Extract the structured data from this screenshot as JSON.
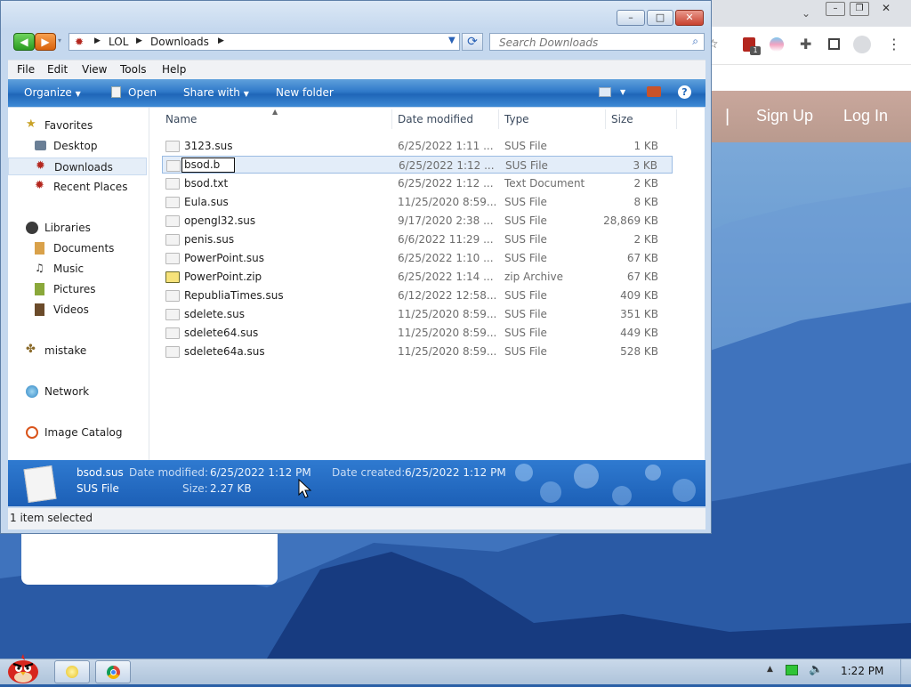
{
  "window": {
    "breadcrumb": [
      "LOL",
      "Downloads"
    ],
    "search_placeholder": "Search Downloads",
    "menu": [
      "File",
      "Edit",
      "View",
      "Tools",
      "Help"
    ],
    "commands": {
      "organize": "Organize",
      "open": "Open",
      "share_with": "Share with",
      "new_folder": "New folder",
      "help": "?"
    },
    "caption": {
      "minimize": "–",
      "maximize": "□",
      "close": "✕"
    }
  },
  "nav": {
    "favorites": "Favorites",
    "desktop": "Desktop",
    "downloads": "Downloads",
    "recent_places": "Recent Places",
    "libraries": "Libraries",
    "documents": "Documents",
    "music": "Music",
    "pictures": "Pictures",
    "videos": "Videos",
    "mistake": "mistake",
    "network": "Network",
    "image_catalog": "Image Catalog"
  },
  "columns": {
    "name": "Name",
    "date": "Date modified",
    "type": "Type",
    "size": "Size"
  },
  "files": [
    {
      "name": "3123.sus",
      "date": "6/25/2022 1:11 ...",
      "type": "SUS File",
      "size": "1 KB"
    },
    {
      "name": "bsod.b",
      "date": "6/25/2022 1:12 ...",
      "type": "SUS File",
      "size": "3 KB"
    },
    {
      "name": "bsod.txt",
      "date": "6/25/2022 1:12 ...",
      "type": "Text Document",
      "size": "2 KB"
    },
    {
      "name": "Eula.sus",
      "date": "11/25/2020 8:59...",
      "type": "SUS File",
      "size": "8 KB"
    },
    {
      "name": "opengl32.sus",
      "date": "9/17/2020 2:38 ...",
      "type": "SUS File",
      "size": "28,869 KB"
    },
    {
      "name": "penis.sus",
      "date": "6/6/2022 11:29 ...",
      "type": "SUS File",
      "size": "2 KB"
    },
    {
      "name": "PowerPoint.sus",
      "date": "6/25/2022 1:10 ...",
      "type": "SUS File",
      "size": "67 KB"
    },
    {
      "name": "PowerPoint.zip",
      "date": "6/25/2022 1:14 ...",
      "type": "zip Archive",
      "size": "67 KB"
    },
    {
      "name": "RepubliaTimes.sus",
      "date": "6/12/2022 12:58...",
      "type": "SUS File",
      "size": "409 KB"
    },
    {
      "name": "sdelete.sus",
      "date": "11/25/2020 8:59...",
      "type": "SUS File",
      "size": "351 KB"
    },
    {
      "name": "sdelete64.sus",
      "date": "11/25/2020 8:59...",
      "type": "SUS File",
      "size": "449 KB"
    },
    {
      "name": "sdelete64a.sus",
      "date": "11/25/2020 8:59...",
      "type": "SUS File",
      "size": "528 KB"
    }
  ],
  "details": {
    "file_name": "bsod.sus",
    "file_type": "SUS File",
    "date_modified_label": "Date modified:",
    "date_modified": "6/25/2022 1:12 PM",
    "date_created_label": "Date created:",
    "date_created": "6/25/2022 1:12 PM",
    "size_label": "Size:",
    "size": "2.27 KB"
  },
  "status": {
    "selection": "1 item selected"
  },
  "browser": {
    "sign_up": "Sign Up",
    "log_in": "Log In",
    "badge": "1"
  },
  "taskbar": {
    "clock": "1:22 PM"
  },
  "colors": {
    "accent": "#1f66b8",
    "selection": "#e3edf9"
  }
}
